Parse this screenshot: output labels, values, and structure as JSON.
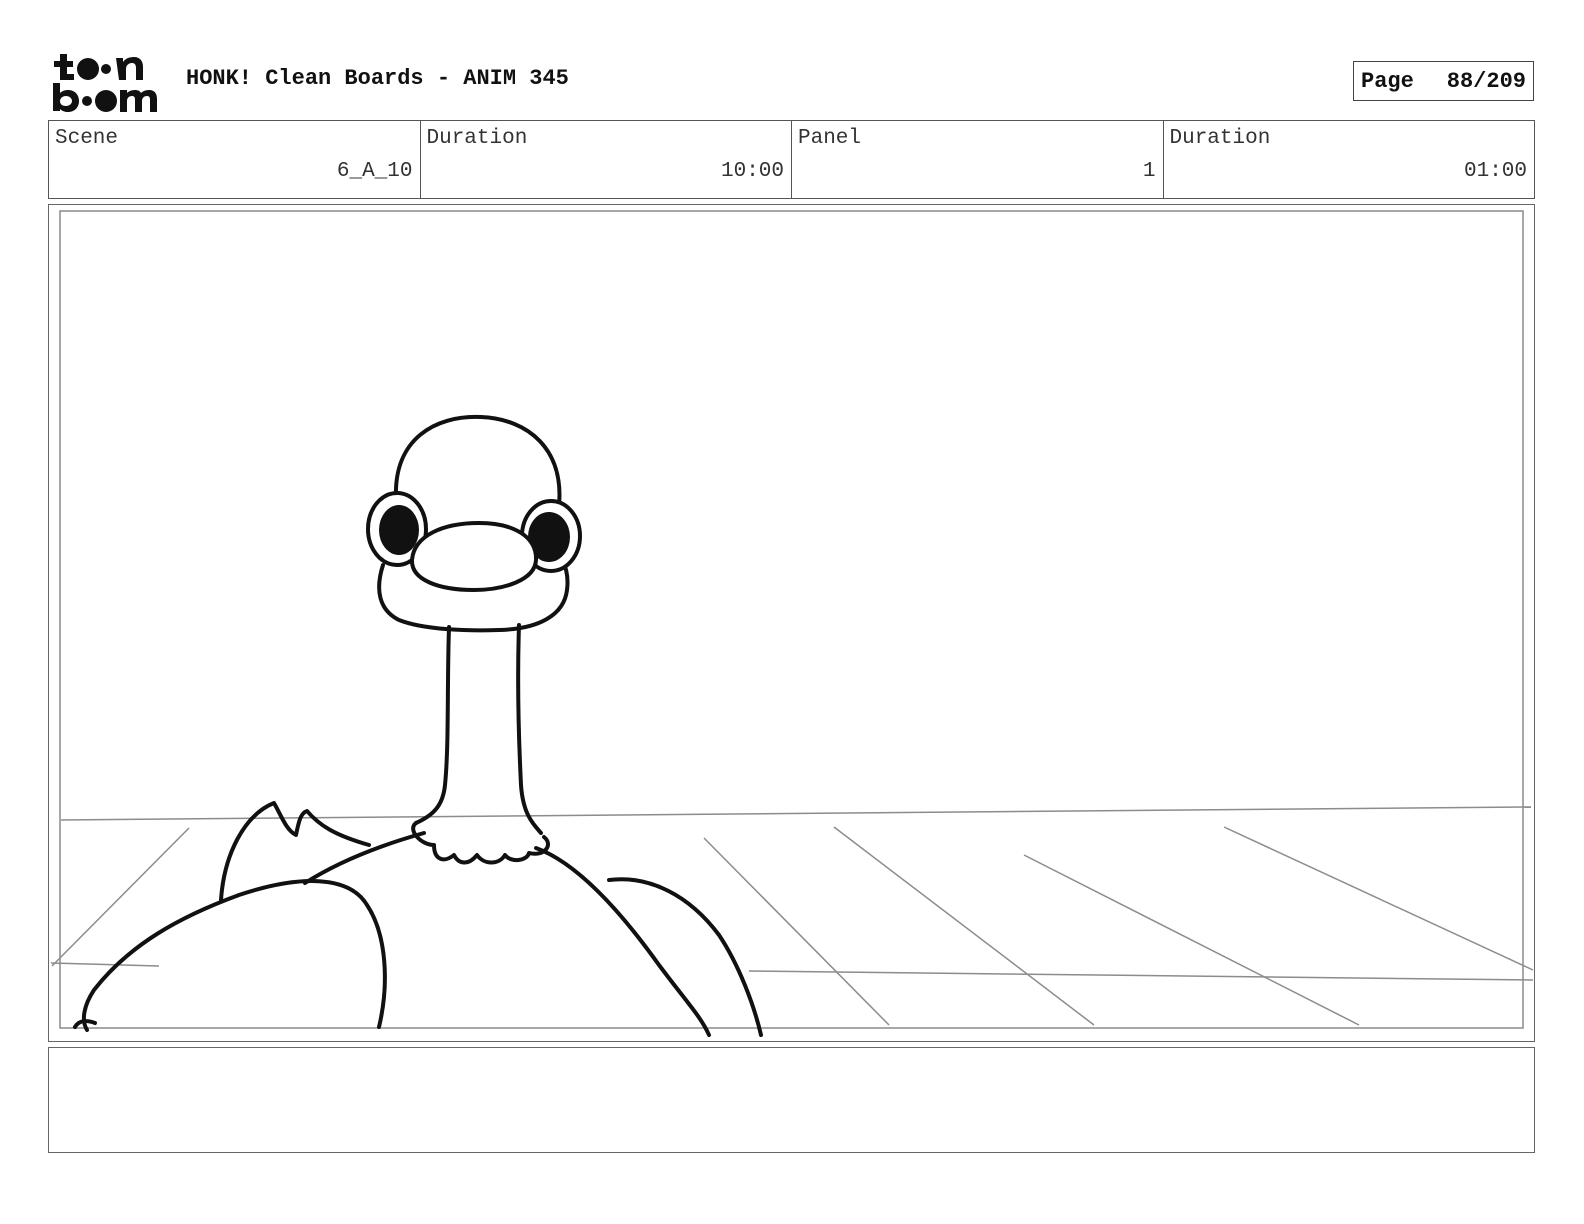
{
  "header": {
    "logo_text": "toon boom",
    "title": "HONK! Clean Boards - ANIM 345",
    "page_label": "Page",
    "page_value": "88/209"
  },
  "info": [
    {
      "label": "Scene",
      "value": "6_A_10"
    },
    {
      "label": "Duration",
      "value": "10:00"
    },
    {
      "label": "Panel",
      "value": "1"
    },
    {
      "label": "Duration",
      "value": "01:00"
    }
  ],
  "panel": {
    "drawing": "goose-icon"
  },
  "notes": {
    "text": ""
  }
}
